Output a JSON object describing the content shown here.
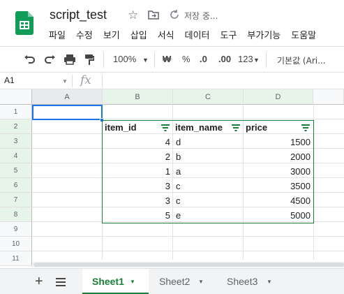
{
  "doc": {
    "title": "script_test",
    "save_status": "저장 중..."
  },
  "menu": [
    "파일",
    "수정",
    "보기",
    "삽입",
    "서식",
    "데이터",
    "도구",
    "부가기능",
    "도움말"
  ],
  "toolbar": {
    "zoom": "100%",
    "currency": "₩",
    "percent": "%",
    "dec_less": ".0",
    "dec_more": ".00",
    "more_formats": "123",
    "font": "기본값 (Ari..."
  },
  "formula_bar": {
    "name_box": "A1",
    "fx": "fx",
    "value": ""
  },
  "columns": [
    "A",
    "B",
    "C",
    "D"
  ],
  "rows": [
    "1",
    "2",
    "3",
    "4",
    "5",
    "6",
    "7",
    "8",
    "9",
    "10",
    "11"
  ],
  "table": {
    "headers": [
      "item_id",
      "item_name",
      "price"
    ],
    "rows": [
      {
        "item_id": "4",
        "item_name": "d",
        "price": "1500"
      },
      {
        "item_id": "2",
        "item_name": "b",
        "price": "2000"
      },
      {
        "item_id": "1",
        "item_name": "a",
        "price": "3000"
      },
      {
        "item_id": "3",
        "item_name": "c",
        "price": "3500"
      },
      {
        "item_id": "3",
        "item_name": "c",
        "price": "4500"
      },
      {
        "item_id": "5",
        "item_name": "e",
        "price": "5000"
      }
    ]
  },
  "sheets": [
    "Sheet1",
    "Sheet2",
    "Sheet3"
  ],
  "active_sheet": "Sheet1",
  "colors": {
    "accent": "#188038",
    "selection": "#1a73e8"
  }
}
